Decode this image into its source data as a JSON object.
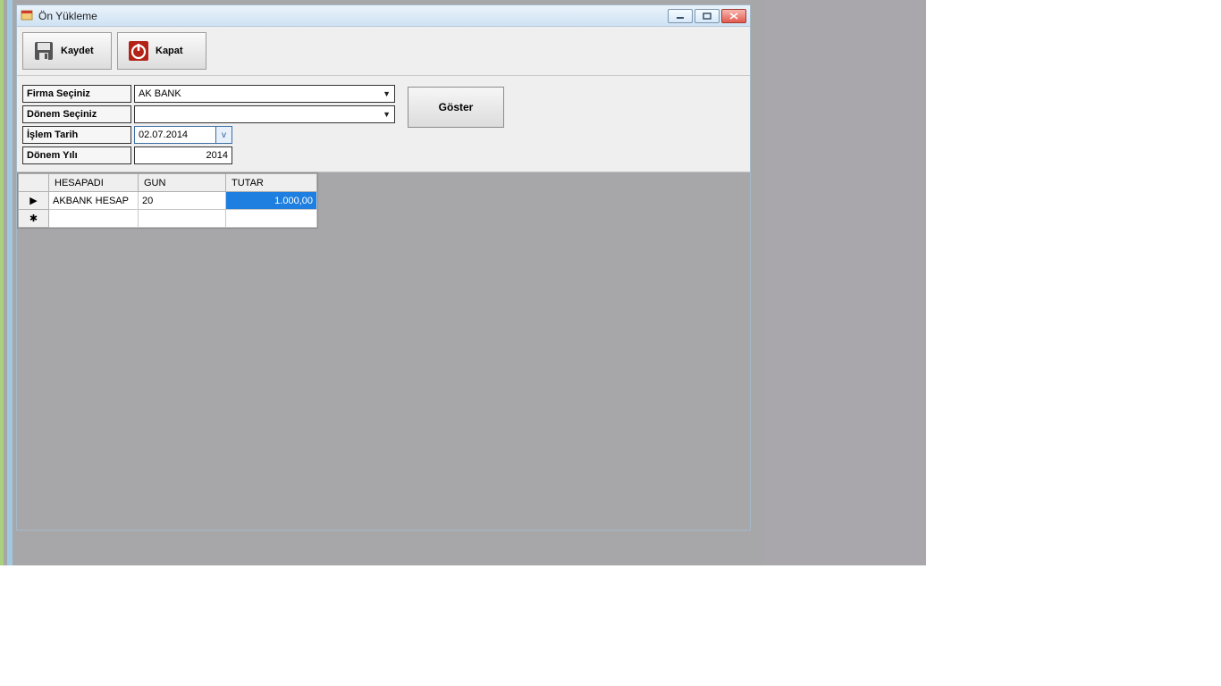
{
  "window": {
    "title": "Ön Yükleme"
  },
  "toolbar": {
    "save_label": "Kaydet",
    "close_label": "Kapat"
  },
  "form": {
    "firma_label": "Firma Seçiniz",
    "firma_value": "AK BANK",
    "donem_label": "Dönem Seçiniz",
    "donem_value": "",
    "islem_tarih_label": "İşlem Tarih",
    "islem_tarih_value": "02.07.2014",
    "donem_yili_label": "Dönem Yılı",
    "donem_yili_value": "2014",
    "goster_label": "Göster"
  },
  "grid": {
    "columns": {
      "hesapadi": "HESAPADI",
      "gun": "GUN",
      "tutar": "TUTAR"
    },
    "rows": [
      {
        "hesapadi": "AKBANK HESAP",
        "gun": "20",
        "tutar": "1.000,00"
      }
    ]
  }
}
